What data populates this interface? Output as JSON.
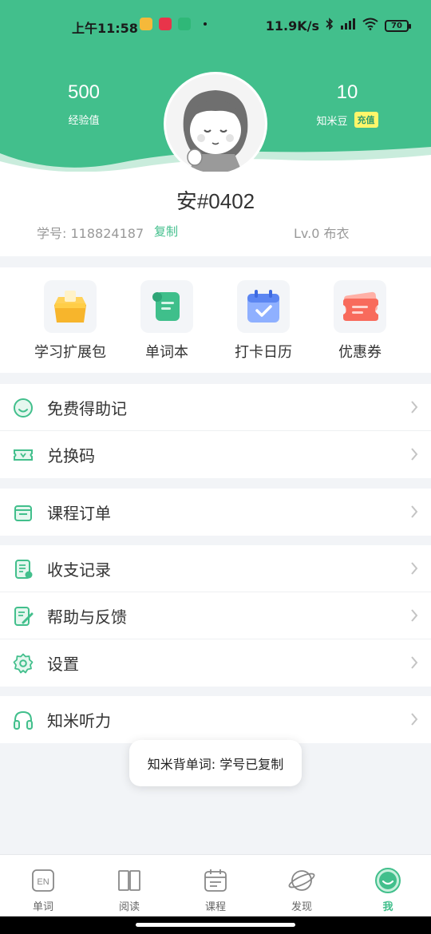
{
  "status_bar": {
    "time": "上午11:58",
    "network_speed": "11.9K/s",
    "battery": "70"
  },
  "header": {
    "exp_value": "500",
    "exp_label": "经验值",
    "beans_value": "10",
    "beans_label": "知米豆",
    "recharge_label": "充值"
  },
  "profile": {
    "username": "安#0402",
    "student_id_label": "学号:",
    "student_id": "118824187",
    "copy_label": "复制",
    "level": "Lv.0 布衣"
  },
  "tiles": [
    {
      "label": "学习扩展包",
      "icon": "package-box-icon"
    },
    {
      "label": "单词本",
      "icon": "wordbook-scroll-icon"
    },
    {
      "label": "打卡日历",
      "icon": "checkin-calendar-icon"
    },
    {
      "label": "优惠券",
      "icon": "coupon-ticket-icon"
    }
  ],
  "menu": {
    "free_mnemonic": "免费得助记",
    "redeem_code": "兑换码",
    "course_orders": "课程订单",
    "transactions": "收支记录",
    "help_feedback": "帮助与反馈",
    "settings": "设置",
    "listening": "知米听力"
  },
  "toast": "知米背单词: 学号已复制",
  "bottom_nav": {
    "words": "单词",
    "reading": "阅读",
    "courses": "课程",
    "discover": "发现",
    "me": "我",
    "en_badge": "EN"
  },
  "colors": {
    "primary": "#42bf8c",
    "recharge_bg": "#fff66a"
  }
}
